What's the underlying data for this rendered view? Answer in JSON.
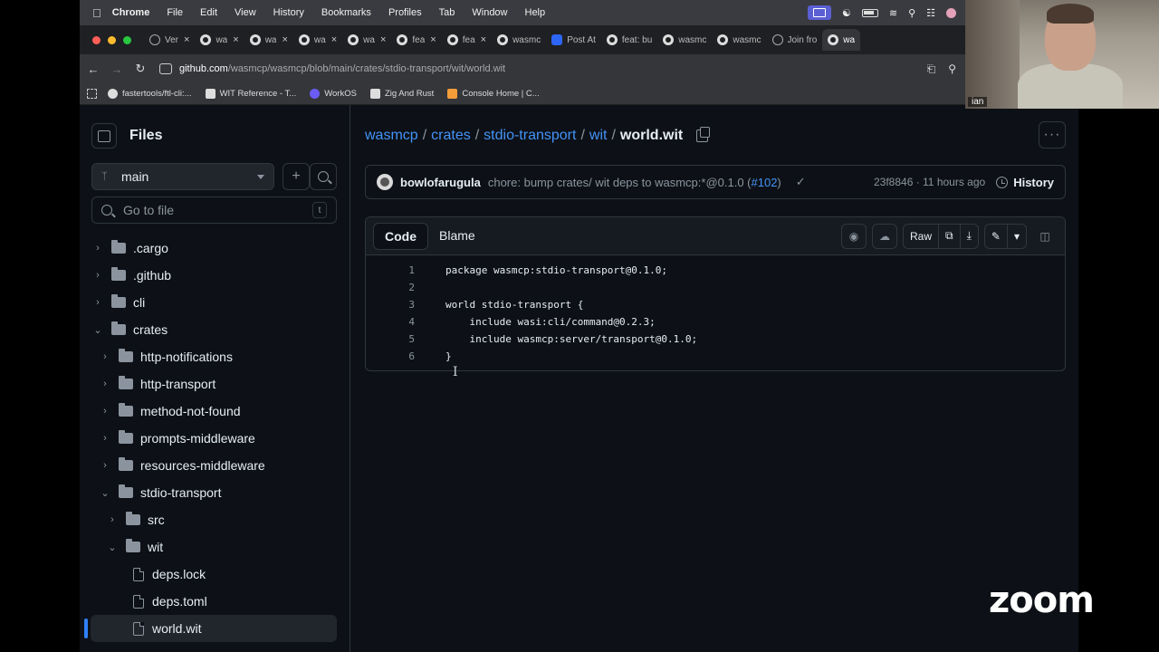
{
  "menubar": {
    "app": "Chrome",
    "items": [
      "File",
      "Edit",
      "View",
      "History",
      "Bookmarks",
      "Profiles",
      "Tab",
      "Window",
      "Help"
    ]
  },
  "tabs": [
    {
      "label": "Ver",
      "icon": "vercel-icon"
    },
    {
      "label": "wa",
      "icon": "github-icon"
    },
    {
      "label": "wa",
      "icon": "github-icon"
    },
    {
      "label": "wa",
      "icon": "github-icon"
    },
    {
      "label": "wa",
      "icon": "github-icon"
    },
    {
      "label": "fea",
      "icon": "github-icon"
    },
    {
      "label": "fea",
      "icon": "github-icon"
    },
    {
      "label": "wasmc",
      "icon": "github-icon"
    },
    {
      "label": "Post At",
      "icon": "zoom-icon"
    },
    {
      "label": "feat: bu",
      "icon": "github-icon"
    },
    {
      "label": "wasmc",
      "icon": "github-icon"
    },
    {
      "label": "wasmc",
      "icon": "github-icon"
    },
    {
      "label": "Join fro",
      "icon": "globe-icon"
    },
    {
      "label": "wa",
      "icon": "github-icon"
    }
  ],
  "url": {
    "domain": "github.com",
    "path": "/wasmcp/wasmcp/blob/main/crates/stdio-transport/wit/world.wit"
  },
  "bookmarks": [
    {
      "label": "fastertools/ftl-cli:...",
      "icon": "github-icon"
    },
    {
      "label": "WIT Reference - T...",
      "icon": "book-icon"
    },
    {
      "label": "WorkOS",
      "icon": "workos-icon"
    },
    {
      "label": "Zig And Rust",
      "icon": "m-icon"
    },
    {
      "label": "Console Home | C...",
      "icon": "aws-icon"
    }
  ],
  "sidebar": {
    "title": "Files",
    "branch": "main",
    "goto_placeholder": "Go to file",
    "goto_key": "t",
    "tree": [
      {
        "label": ".cargo",
        "type": "folder",
        "depth": 0,
        "expanded": false
      },
      {
        "label": ".github",
        "type": "folder",
        "depth": 0,
        "expanded": false
      },
      {
        "label": "cli",
        "type": "folder",
        "depth": 0,
        "expanded": false
      },
      {
        "label": "crates",
        "type": "folder",
        "depth": 0,
        "expanded": true
      },
      {
        "label": "http-notifications",
        "type": "folder",
        "depth": 1,
        "expanded": false
      },
      {
        "label": "http-transport",
        "type": "folder",
        "depth": 1,
        "expanded": false
      },
      {
        "label": "method-not-found",
        "type": "folder",
        "depth": 1,
        "expanded": false
      },
      {
        "label": "prompts-middleware",
        "type": "folder",
        "depth": 1,
        "expanded": false
      },
      {
        "label": "resources-middleware",
        "type": "folder",
        "depth": 1,
        "expanded": false
      },
      {
        "label": "stdio-transport",
        "type": "folder",
        "depth": 1,
        "expanded": true
      },
      {
        "label": "src",
        "type": "folder",
        "depth": 2,
        "expanded": false
      },
      {
        "label": "wit",
        "type": "folder",
        "depth": 2,
        "expanded": true
      },
      {
        "label": "deps.lock",
        "type": "file",
        "depth": 3
      },
      {
        "label": "deps.toml",
        "type": "file",
        "depth": 3
      },
      {
        "label": "world.wit",
        "type": "file",
        "depth": 3,
        "selected": true
      }
    ]
  },
  "breadcrumb": {
    "parts": [
      "wasmcp",
      "crates",
      "stdio-transport",
      "wit"
    ],
    "current": "world.wit"
  },
  "commit": {
    "author": "bowlofarugula",
    "message": "chore: bump crates/ wit deps to wasmcp:*@0.1.0 (",
    "pr": "#102",
    "message_end": ")",
    "sha_time": "23f8846 · 11 hours ago",
    "history_label": "History"
  },
  "code_view": {
    "tab_code": "Code",
    "tab_blame": "Blame",
    "raw_label": "Raw",
    "lines": [
      {
        "n": "1",
        "text": "package wasmcp:stdio-transport@0.1.0;"
      },
      {
        "n": "2",
        "text": ""
      },
      {
        "n": "3",
        "text": "world stdio-transport {"
      },
      {
        "n": "4",
        "text": "    include wasi:cli/command@0.2.3;"
      },
      {
        "n": "5",
        "text": "    include wasmcp:server/transport@0.1.0;"
      },
      {
        "n": "6",
        "text": "}"
      }
    ]
  },
  "webcam": {
    "name": "ian"
  },
  "watermark": "zoom",
  "colors": {
    "link": "#4493f8",
    "bg": "#0d1117",
    "border": "#30363d"
  }
}
